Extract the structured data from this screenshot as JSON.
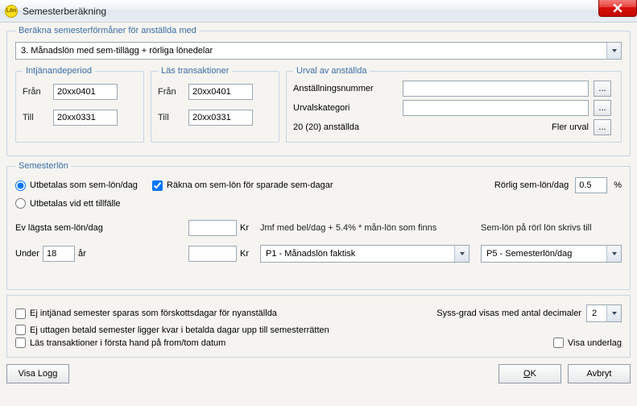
{
  "window": {
    "title": "Semesterberäkning",
    "icon_label": "Lön"
  },
  "groups": {
    "main": "Beräkna semesterförmåner för anställda med",
    "intj": "Intjänandeperiod",
    "las": "Läs transaktioner",
    "urval": "Urval av anställda",
    "semlon": "Semesterlön"
  },
  "main_combo": "3.   Månadslön med sem-tillägg + rörliga lönedelar",
  "labels": {
    "fran": "Från",
    "till": "Till",
    "anstnr": "Anställningsnummer",
    "urvalkat": "Urvalskategori",
    "count": "20 (20) anställda",
    "fler": "Fler urval",
    "dots": "...",
    "radio1": "Utbetalas som sem-lön/dag",
    "chk_rakna": "Räkna om sem-lön för sparade sem-dagar",
    "rorlig": "Rörlig sem-lön/dag",
    "pct": "%",
    "radio2": "Utbetalas vid ett tillfälle",
    "ev_lagsta": "Ev lägsta sem-lön/dag",
    "kr": "Kr",
    "under": "Under",
    "ar": "år",
    "jmf": "Jmf med bel/dag + 5.4% * mån-lön som finns",
    "skrivs": "Sem-lön på rörl lön skrivs till",
    "chk_ej_intj": "Ej intjänad semester sparas som förskottsdagar för nyanställda",
    "chk_ej_utt": "Ej uttagen betald semester ligger kvar i betalda dagar upp till semesterrätten",
    "chk_las": "Läs transaktioner i första hand på from/tom datum",
    "syss": "Syss-grad visas med antal decimaler",
    "visa_underlag": "Visa underlag"
  },
  "values": {
    "intj_fran": "20xx0401",
    "intj_till": "20xx0331",
    "las_fran": "20xx0401",
    "las_till": "20xx0331",
    "anstnr": "",
    "urvalkat": "",
    "rorlig_pct": "0.5",
    "ev_lagsta": "",
    "under_age": "18",
    "under_kr": "",
    "jmf_combo": "P1 - Månadslön faktisk",
    "skrivs_combo": "P5 - Semesterlön/dag",
    "decimals": "2"
  },
  "buttons": {
    "visa_logg": "Visa Logg",
    "ok": "OK",
    "avbryt": "Avbryt"
  }
}
